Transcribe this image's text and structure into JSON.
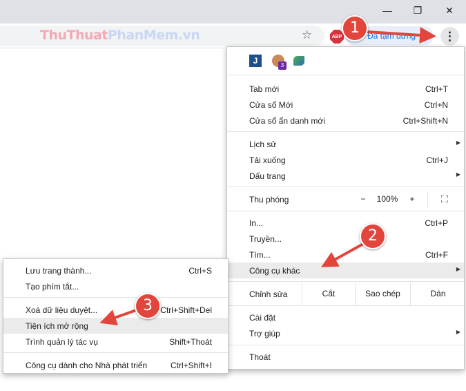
{
  "window": {
    "minimize_icon": "minimize-icon",
    "restore_icon": "restore-icon",
    "close_icon": "close-icon",
    "minimize_glyph": "—",
    "restore_glyph": "❐",
    "close_glyph": "✕"
  },
  "toolbar": {
    "watermark_part1": "ThuThuat",
    "watermark_part2": "PhanMem.vn",
    "bookmark_glyph": "☆",
    "abp_label": "ABP",
    "profile_status": "Đã tạm dừng",
    "menu_glyph": "⋮"
  },
  "main_menu": {
    "extension_icon_badge": "3",
    "extension_j": "J",
    "groups": {
      "new": [
        {
          "label": "Tab mới",
          "shortcut": "Ctrl+T"
        },
        {
          "label": "Cửa sổ Mới",
          "shortcut": "Ctrl+N"
        },
        {
          "label": "Cửa sổ ẩn danh mới",
          "shortcut": "Ctrl+Shift+N"
        }
      ],
      "nav": [
        {
          "label": "Lịch sử",
          "shortcut": ""
        },
        {
          "label": "Tải xuống",
          "shortcut": "Ctrl+J"
        },
        {
          "label": "Dấu trang",
          "shortcut": ""
        }
      ],
      "zoom": {
        "label": "Thu phóng",
        "minus": "−",
        "value": "100%",
        "plus": "+",
        "fullscreen": "⛶"
      },
      "tools": [
        {
          "label": "In...",
          "shortcut": "Ctrl+P"
        },
        {
          "label": "Truyền...",
          "shortcut": ""
        },
        {
          "label": "Tìm...",
          "shortcut": "Ctrl+F"
        },
        {
          "label": "Công cụ khác",
          "shortcut": ""
        }
      ],
      "edit": {
        "label": "Chỉnh sửa",
        "cut": "Cắt",
        "copy": "Sao chép",
        "paste": "Dán"
      },
      "settings": [
        {
          "label": "Cài đặt",
          "shortcut": ""
        },
        {
          "label": "Trợ giúp",
          "shortcut": ""
        }
      ],
      "exit": {
        "label": "Thoát"
      }
    },
    "submenu_arrow": "▶"
  },
  "sub_menu": {
    "items": [
      {
        "label": "Lưu trang thành...",
        "shortcut": "Ctrl+S"
      },
      {
        "label": "Tạo phím tắt...",
        "shortcut": ""
      },
      {
        "label": "Xoá dữ liệu duyệt...",
        "shortcut": "Ctrl+Shift+Del"
      },
      {
        "label": "Tiện ích mở rộng",
        "shortcut": ""
      },
      {
        "label": "Trình quản lý tác vụ",
        "shortcut": "Shift+Thoát"
      },
      {
        "label": "Công cụ dành cho Nhà phát triển",
        "shortcut": "Ctrl+Shift+I"
      }
    ]
  },
  "annotations": {
    "step1": "1",
    "step2": "2",
    "step3": "3",
    "color": "#e2453b"
  }
}
